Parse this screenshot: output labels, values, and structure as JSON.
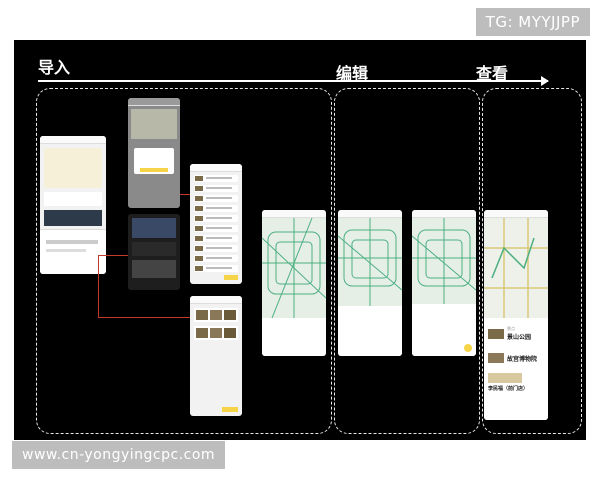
{
  "watermarks": {
    "top_right": "TG: MYYJJPP",
    "bottom_left": "www.cn-yongyingcpc.com"
  },
  "phases": {
    "import": "导入",
    "edit": "编辑",
    "view": "查看"
  },
  "result_list": {
    "items": [
      {
        "tag": "景点",
        "name": "景山公园"
      },
      {
        "tag": "",
        "name": "故宫博物院"
      },
      {
        "tag": "",
        "name": "李民福（前门店）"
      }
    ]
  },
  "colors": {
    "board": "#000000",
    "accent": "#f5d547",
    "connector": "#c0392b",
    "map_road": "#4caf80"
  }
}
